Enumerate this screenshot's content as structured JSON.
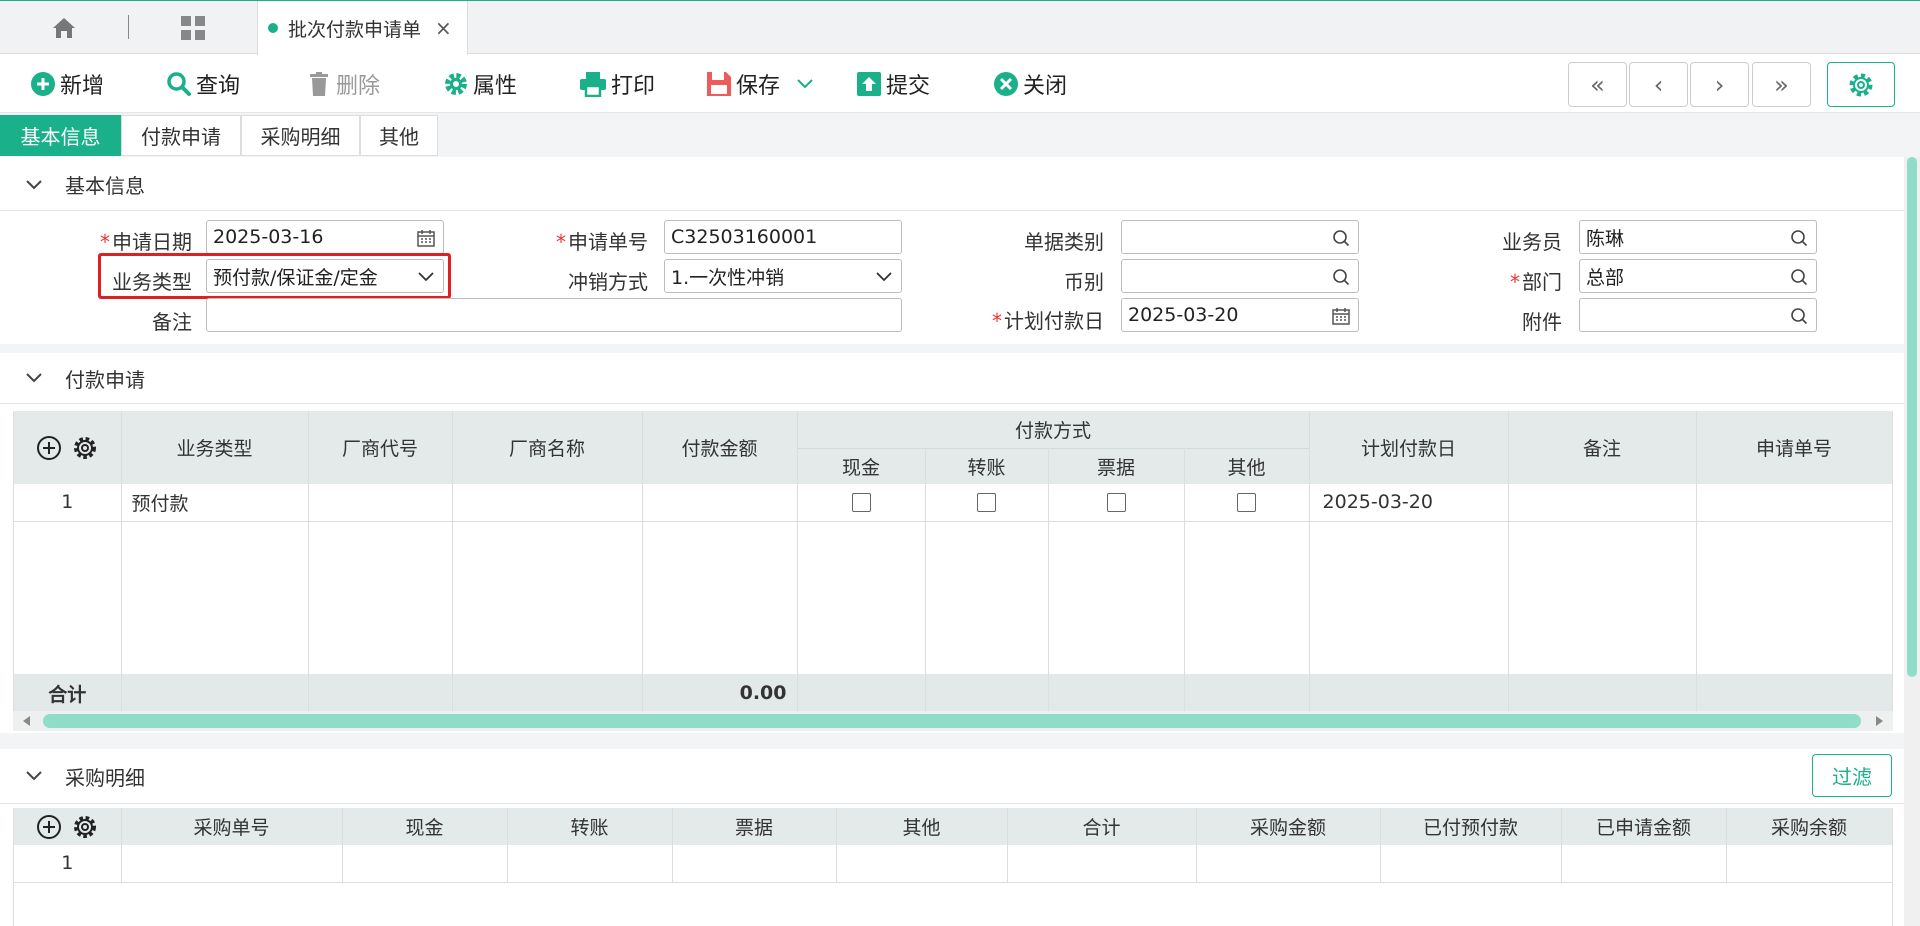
{
  "tabbar": {
    "doc_tab_title": "批次付款申请单",
    "close_glyph": "×"
  },
  "toolbar": {
    "add": "新增",
    "query": "查询",
    "delete": "删除",
    "properties": "属性",
    "print": "打印",
    "save": "保存",
    "submit": "提交",
    "close": "关闭",
    "nav": [
      "«",
      "‹",
      "›",
      "»"
    ]
  },
  "section_tabs": [
    "基本信息",
    "付款申请",
    "采购明细",
    "其他"
  ],
  "basic_info": {
    "title": "基本信息",
    "apply_date_label": "申请日期",
    "apply_date": "2025-03-16",
    "apply_no_label": "申请单号",
    "apply_no": "C32503160001",
    "doc_type_label": "单据类别",
    "doc_type": "",
    "staff_label": "业务员",
    "staff": "陈琳",
    "biz_type_label": "业务类型",
    "biz_type": "预付款/保证金/定金",
    "writeoff_label": "冲销方式",
    "writeoff": "1.一次性冲销",
    "currency_label": "币别",
    "currency": "",
    "dept_label": "部门",
    "dept": "总部",
    "remark_label": "备注",
    "remark": "",
    "plan_date_label": "计划付款日",
    "plan_date": "2025-03-20",
    "attach_label": "附件",
    "attach": "",
    "required_mark": "*"
  },
  "payment": {
    "title": "付款申请",
    "headers": {
      "biz_type": "业务类型",
      "vendor_code": "厂商代号",
      "vendor_name": "厂商名称",
      "amount": "付款金额",
      "method": "付款方式",
      "cash": "现金",
      "transfer": "转账",
      "bill": "票据",
      "other": "其他",
      "plan_date": "计划付款日",
      "remark": "备注",
      "apply_no": "申请单号"
    },
    "rows": [
      {
        "idx": "1",
        "biz_type": "预付款",
        "plan_date": "2025-03-20"
      }
    ],
    "total_label": "合计",
    "total_amount": "0.00"
  },
  "purchase": {
    "title": "采购明细",
    "filter": "过滤",
    "headers": [
      "采购单号",
      "现金",
      "转账",
      "票据",
      "其他",
      "合计",
      "采购金额",
      "已付预付款",
      "已申请金额",
      "采购余额"
    ],
    "rows": [
      {
        "idx": "1"
      }
    ]
  },
  "colors": {
    "accent": "#19b08a",
    "required": "#e33333",
    "highlight_box": "#e02020"
  }
}
